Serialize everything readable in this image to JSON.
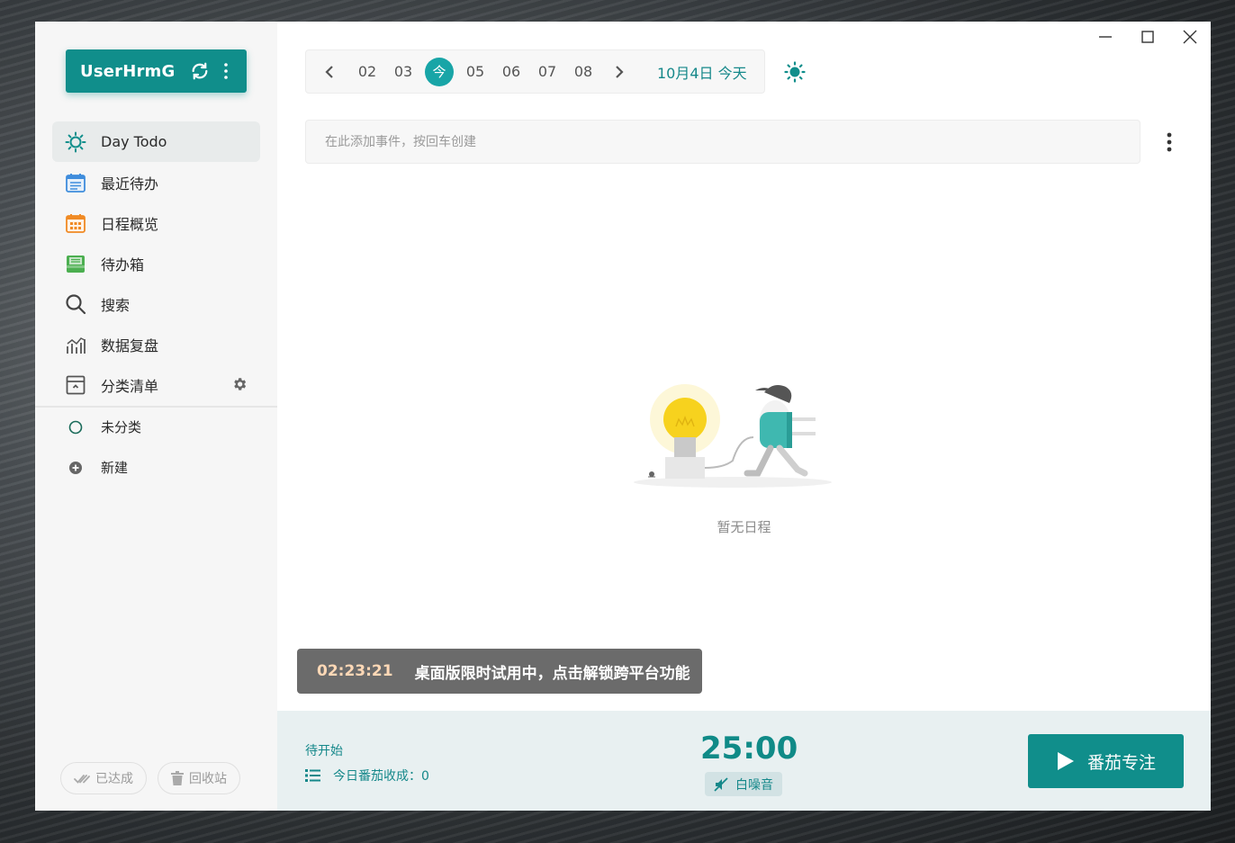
{
  "user": {
    "name": "UserHrmG"
  },
  "nav": {
    "items": [
      {
        "label": "Day Todo",
        "icon": "sun-icon",
        "active": true
      },
      {
        "label": "最近待办",
        "icon": "list-calendar-icon"
      },
      {
        "label": "日程概览",
        "icon": "calendar-grid-icon"
      },
      {
        "label": "待办箱",
        "icon": "inbox-icon"
      },
      {
        "label": "搜索",
        "icon": "search-icon"
      },
      {
        "label": "数据复盘",
        "icon": "bar-chart-icon"
      },
      {
        "label": "分类清单",
        "icon": "archive-icon"
      }
    ],
    "categories": [
      {
        "label": "未分类",
        "icon": "circle-icon"
      },
      {
        "label": "新建",
        "icon": "plus-circle-icon"
      }
    ]
  },
  "bottom": {
    "done_label": "已达成",
    "trash_label": "回收站"
  },
  "datebar": {
    "days": [
      "02",
      "03",
      "今",
      "05",
      "06",
      "07",
      "08"
    ],
    "today_index": 2,
    "current_label": "10月4日 今天"
  },
  "event_input": {
    "placeholder": "在此添加事件，按回车创建",
    "value": ""
  },
  "empty_state": {
    "text": "暂无日程"
  },
  "trial_banner": {
    "countdown": "02:23:21",
    "message": "桌面版限时试用中，点击解锁跨平台功能"
  },
  "pomodoro": {
    "status": "待开始",
    "count_label": "今日番茄收成：0",
    "timer": "25:00",
    "noise_label": "白噪音",
    "focus_label": "番茄专注"
  },
  "colors": {
    "accent": "#108e8b",
    "accent_light": "#18a5a7",
    "sidebar_bg": "#f6f6f6",
    "footer_bg": "#e8f0f1"
  }
}
